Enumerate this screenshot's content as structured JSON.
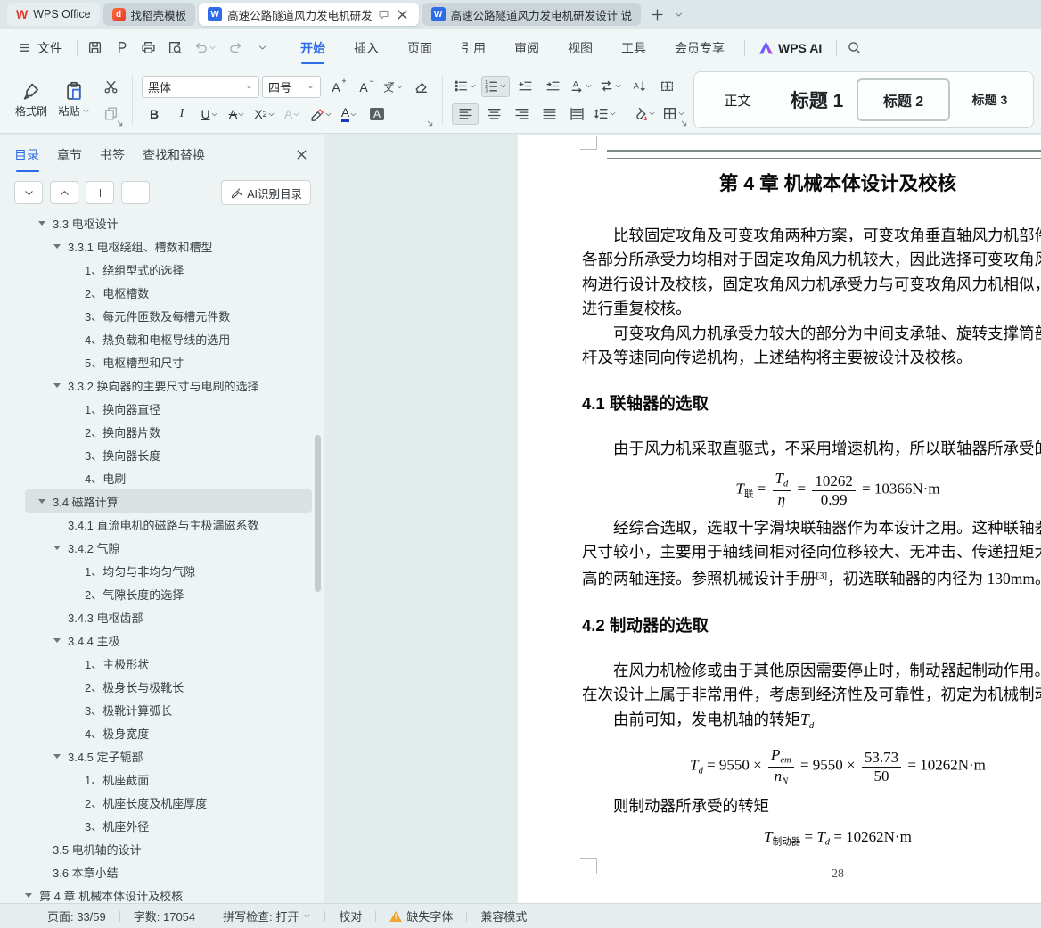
{
  "window_tabs": {
    "tabs": [
      {
        "label": "WPS Office",
        "type": "home",
        "active": false
      },
      {
        "label": "找稻壳模板",
        "type": "docer",
        "active": false
      },
      {
        "label": "高速公路隧道风力发电机研发",
        "type": "doc",
        "active": true,
        "has_comment_icon": true,
        "has_close": true
      },
      {
        "label": "高速公路隧道风力发电机研发设计 说",
        "type": "doc",
        "active": false
      }
    ]
  },
  "menu": {
    "file_label": "文件",
    "items": [
      "开始",
      "插入",
      "页面",
      "引用",
      "审阅",
      "视图",
      "工具",
      "会员专享"
    ],
    "active_item": "开始",
    "wps_ai_label": "WPS AI"
  },
  "toolbar": {
    "format_painter_label": "格式刷",
    "paste_label": "粘贴",
    "font_name": "黑体",
    "font_size": "四号"
  },
  "styles_gallery": [
    {
      "label": "正文",
      "selected": false
    },
    {
      "label": "标题 1",
      "selected": false
    },
    {
      "label": "标题 2",
      "selected": true
    },
    {
      "label": "标题 3",
      "selected": false
    }
  ],
  "sidebar": {
    "tabs": [
      {
        "label": "目录",
        "active": true
      },
      {
        "label": "章节",
        "active": false
      },
      {
        "label": "书签",
        "active": false
      },
      {
        "label": "查找和替换",
        "active": false
      }
    ],
    "ai_button_label": "AI识别目录",
    "toc": [
      {
        "level": 1,
        "expand": true,
        "text": "3.3 电枢设计"
      },
      {
        "level": 2,
        "expand": true,
        "text": "3.3.1 电枢绕组、槽数和槽型"
      },
      {
        "level": 3,
        "expand": false,
        "text": "1、绕组型式的选择"
      },
      {
        "level": 3,
        "expand": false,
        "text": "2、电枢槽数"
      },
      {
        "level": 3,
        "expand": false,
        "text": "3、每元件匝数及每槽元件数"
      },
      {
        "level": 3,
        "expand": false,
        "text": "4、热负载和电枢导线的选用"
      },
      {
        "level": 3,
        "expand": false,
        "text": "5、电枢槽型和尺寸"
      },
      {
        "level": 2,
        "expand": true,
        "text": "3.3.2 换向器的主要尺寸与电刷的选择"
      },
      {
        "level": 3,
        "expand": false,
        "text": "1、换向器直径"
      },
      {
        "level": 3,
        "expand": false,
        "text": "2、换向器片数"
      },
      {
        "level": 3,
        "expand": false,
        "text": "3、换向器长度"
      },
      {
        "level": 3,
        "expand": false,
        "text": "4、电刷"
      },
      {
        "level": 1,
        "expand": true,
        "selected": true,
        "text": "3.4 磁路计算"
      },
      {
        "level": 2,
        "expand": false,
        "text": "3.4.1 直流电机的磁路与主极漏磁系数"
      },
      {
        "level": 2,
        "expand": true,
        "text": "3.4.2 气隙"
      },
      {
        "level": 3,
        "expand": false,
        "text": "1、均匀与非均匀气隙"
      },
      {
        "level": 3,
        "expand": false,
        "text": "2、气隙长度的选择"
      },
      {
        "level": 2,
        "expand": false,
        "text": "3.4.3 电枢齿部"
      },
      {
        "level": 2,
        "expand": true,
        "text": "3.4.4 主极"
      },
      {
        "level": 3,
        "expand": false,
        "text": "1、主极形状"
      },
      {
        "level": 3,
        "expand": false,
        "text": "2、极身长与极靴长"
      },
      {
        "level": 3,
        "expand": false,
        "text": "3、极靴计算弧长"
      },
      {
        "level": 3,
        "expand": false,
        "text": "4、极身宽度"
      },
      {
        "level": 2,
        "expand": true,
        "text": "3.4.5 定子轭部"
      },
      {
        "level": 3,
        "expand": false,
        "text": "1、机座截面"
      },
      {
        "level": 3,
        "expand": false,
        "text": "2、机座长度及机座厚度"
      },
      {
        "level": 3,
        "expand": false,
        "text": "3、机座外径"
      },
      {
        "level": 1,
        "expand": false,
        "text": "3.5 电机轴的设计"
      },
      {
        "level": 1,
        "expand": false,
        "text": "3.6 本章小结"
      },
      {
        "level": 0,
        "expand": true,
        "text": "第 4 章 机械本体设计及校核"
      }
    ]
  },
  "document": {
    "page_number": "28",
    "blocks": [
      {
        "type": "h1",
        "text": "第 4 章 机械本体设计及校核"
      },
      {
        "type": "para",
        "lines": [
          {
            "indent": 1,
            "runs": [
              {
                "t": "比较固定攻角及可变攻角两种方案，可变攻角垂直轴风力机部件较"
              }
            ]
          },
          {
            "runs": [
              {
                "t": "各部分所承受力均相对于固定攻角风力机较大，因此选择可变攻角风力"
              }
            ]
          },
          {
            "runs": [
              {
                "t": "构进行设计及校核，固定攻角风力机承受力与可变攻角风力机相似，因"
              }
            ]
          },
          {
            "runs": [
              {
                "t": "进行重复校核。"
              }
            ]
          }
        ]
      },
      {
        "type": "para",
        "lines": [
          {
            "indent": 1,
            "runs": [
              {
                "t": "可变攻角风力机承受力较大的部分为中间支承轴、旋转支撑筒部分"
              }
            ]
          },
          {
            "runs": [
              {
                "t": "杆及等速同向传递机构，上述结构将主要被设计及校核。"
              }
            ]
          }
        ]
      },
      {
        "type": "h2",
        "text": "4.1 联轴器的选取"
      },
      {
        "type": "para",
        "lines": [
          {
            "indent": 1,
            "runs": [
              {
                "t": "由于风力机采取直驱式，不采用增速机构，所以联轴器所承受的转"
              }
            ]
          }
        ]
      },
      {
        "type": "formula",
        "index": 0
      },
      {
        "type": "para",
        "lines": [
          {
            "indent": 1,
            "runs": [
              {
                "t": "经综合选取，选取十字滑块联轴器作为本设计之用。这种联轴器的"
              }
            ]
          },
          {
            "runs": [
              {
                "t": "尺寸较小，主要用于轴线间相对径向位移较大、无冲击、传递扭矩大转"
              }
            ]
          },
          {
            "runs": [
              {
                "t": "高的两轴连接。参照机械设计手册"
              },
              {
                "t": "[3]",
                "sup": 1
              },
              {
                "t": "，初选联轴器的内径为 130mm。"
              }
            ]
          }
        ]
      },
      {
        "type": "h2",
        "text": "4.2 制动器的选取"
      },
      {
        "type": "para",
        "lines": [
          {
            "indent": 1,
            "runs": [
              {
                "t": "在风力机检修或由于其他原因需要停止时，制动器起制动作用。制"
              }
            ]
          },
          {
            "runs": [
              {
                "t": "在次设计上属于非常用件，考虑到经济性及可靠性，初定为机械制动。"
              }
            ]
          },
          {
            "indent": 1,
            "runs": [
              {
                "t": "由前可知，发电机轴的转矩"
              },
              {
                "t": "T",
                "it": 1
              },
              {
                "t": "d",
                "it": 1,
                "sub": 1
              }
            ]
          }
        ]
      },
      {
        "type": "formula",
        "index": 1
      },
      {
        "type": "para",
        "lines": [
          {
            "indent": 1,
            "runs": [
              {
                "t": "则制动器所承受的转矩"
              }
            ]
          }
        ]
      },
      {
        "type": "formula",
        "index": 2
      }
    ],
    "formulas": [
      {
        "segments": [
          {
            "type": "runs",
            "runs": [
              {
                "t": "T",
                "it": 1
              },
              {
                "t": "联",
                "sub": 1
              },
              {
                "t": " = "
              }
            ]
          },
          {
            "type": "frac",
            "num": [
              {
                "t": "T",
                "it": 1
              },
              {
                "t": "d",
                "it": 1,
                "sub": 1
              }
            ],
            "den": [
              {
                "t": "η",
                "it": 1
              }
            ]
          },
          {
            "type": "runs",
            "runs": [
              {
                "t": " = "
              }
            ]
          },
          {
            "type": "frac",
            "num": [
              {
                "t": "10262"
              }
            ],
            "den": [
              {
                "t": "0.99"
              }
            ]
          },
          {
            "type": "runs",
            "runs": [
              {
                "t": " = 10366N·m"
              }
            ]
          }
        ]
      },
      {
        "segments": [
          {
            "type": "runs",
            "runs": [
              {
                "t": "T",
                "it": 1
              },
              {
                "t": "d",
                "it": 1,
                "sub": 1
              },
              {
                "t": " = 9550 × "
              }
            ]
          },
          {
            "type": "frac",
            "num": [
              {
                "t": "P",
                "it": 1
              },
              {
                "t": "em",
                "it": 1,
                "sub": 1
              }
            ],
            "den": [
              {
                "t": "n",
                "it": 1
              },
              {
                "t": "N",
                "it": 1,
                "sub": 1
              }
            ]
          },
          {
            "type": "runs",
            "runs": [
              {
                "t": " = 9550 × "
              }
            ]
          },
          {
            "type": "frac",
            "num": [
              {
                "t": "53.73"
              }
            ],
            "den": [
              {
                "t": "50"
              }
            ]
          },
          {
            "type": "runs",
            "runs": [
              {
                "t": " = 10262N·m"
              }
            ]
          }
        ]
      },
      {
        "segments": [
          {
            "type": "runs",
            "runs": [
              {
                "t": "T",
                "it": 1
              },
              {
                "t": "制动器",
                "sub": 1
              },
              {
                "t": " = "
              },
              {
                "t": "T",
                "it": 1
              },
              {
                "t": "d",
                "it": 1,
                "sub": 1
              },
              {
                "t": " = 10262N·m"
              }
            ]
          }
        ]
      }
    ]
  },
  "statusbar": {
    "items": [
      {
        "label": "页面: 33/59"
      },
      {
        "label": "字数: 17054"
      },
      {
        "label": "拼写检查: 打开",
        "chevron": true
      },
      {
        "label": "校对"
      },
      {
        "label": "缺失字体",
        "warning": true
      },
      {
        "label": "兼容模式"
      }
    ]
  },
  "colors": {
    "accent_blue": "#2e6be6",
    "doc_icon_blue": "#2e6be6",
    "wps_red": "#e13b30",
    "font_color_indicator": "#1d39c4",
    "warning_orange": "#f2a52e",
    "canvas_gray": "#e3ecec",
    "selected_toc_bg": "#dbe1e1"
  }
}
